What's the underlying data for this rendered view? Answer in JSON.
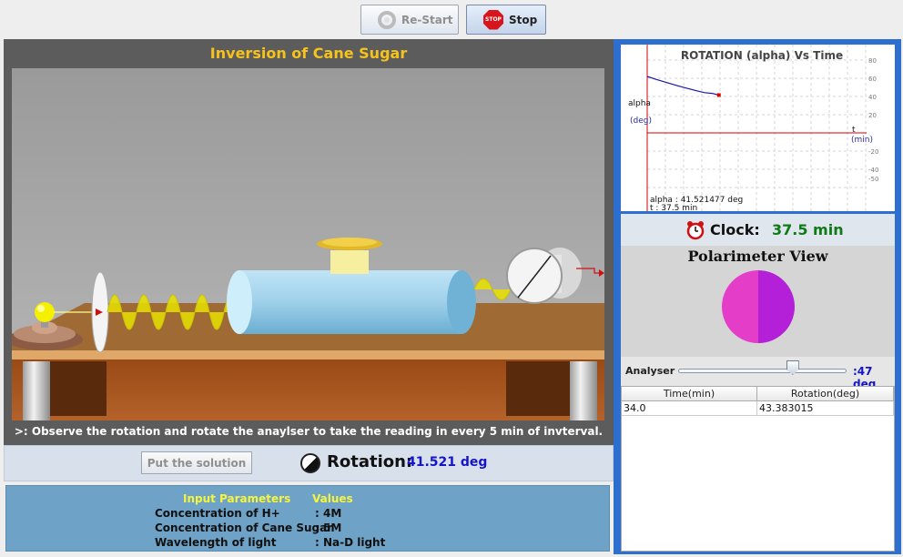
{
  "toolbar": {
    "restart_label": "Re-Start",
    "stop_label": "Stop",
    "stop_icon_text": "STOP"
  },
  "simulation": {
    "title": "Inversion of Cane Sugar",
    "instruction": ">: Observe the rotation and rotate the anaylser to take the reading in every 5 min of invterval."
  },
  "controls": {
    "put_solution_label": "Put the solution",
    "rotation_label": "Rotation:",
    "rotation_value": "41.521 deg"
  },
  "parameters": {
    "header_input": "Input Parameters",
    "header_values": "Values",
    "rows": [
      {
        "label": "Concentration of H+",
        "value": ": 4M"
      },
      {
        "label": "Concentration of Cane Sugar",
        "value": ": 5M"
      },
      {
        "label": "Wavelength of light",
        "value": ": Na-D light"
      }
    ]
  },
  "graph": {
    "title": "ROTATION (alpha) Vs Time",
    "ylabel": "alpha",
    "yunit": "(deg)",
    "xlabel": "t",
    "xunit": "(min)",
    "y_ticks": [
      "60",
      "40",
      "20",
      "-20",
      "-40",
      "-50"
    ],
    "top_tick": "80",
    "readout_alpha": "alpha : 41.521477 deg",
    "readout_t": "t : 37.5 min"
  },
  "chart_data": {
    "type": "line",
    "title": "ROTATION (alpha) Vs Time",
    "xlabel": "t (min)",
    "ylabel": "alpha (deg)",
    "series": [
      {
        "x": [
          0,
          5,
          10,
          15,
          20,
          25,
          30,
          34,
          37.5
        ],
        "y": [
          62,
          58.6,
          55.4,
          52.3,
          49.4,
          46.7,
          44.2,
          43.4,
          41.5
        ]
      }
    ],
    "ylim": [
      -55,
      85
    ],
    "grid": true
  },
  "clock": {
    "label": "Clock:",
    "value": "37.5 min"
  },
  "polarimeter": {
    "title": "Polarimeter View",
    "left_color": "#e43ec8",
    "right_color": "#b420d8"
  },
  "analyser": {
    "label": "Analyser",
    "value": ":47 deg",
    "level": 0.68
  },
  "table": {
    "headers": [
      "Time(min)",
      "Rotation(deg)"
    ],
    "rows": [
      [
        "34.0",
        "43.383015"
      ]
    ]
  }
}
